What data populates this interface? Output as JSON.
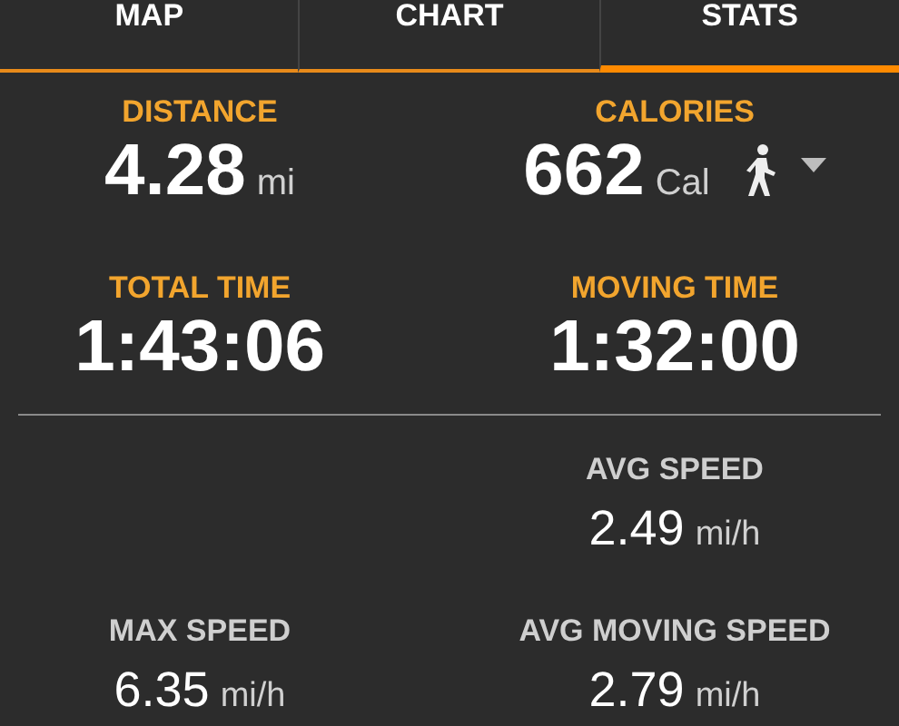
{
  "tabs": [
    {
      "label": "MAP",
      "selected": false
    },
    {
      "label": "CHART",
      "selected": false
    },
    {
      "label": "STATS",
      "selected": true
    }
  ],
  "summary_rows": [
    {
      "left": {
        "label": "DISTANCE",
        "value": "4.28",
        "unit": "mi",
        "activity_picker": false
      },
      "right": {
        "label": "CALORIES",
        "value": "662",
        "unit": "Cal",
        "activity_picker": true
      }
    },
    {
      "left": {
        "label": "TOTAL TIME",
        "value": "1:43:06",
        "activity_picker": false
      },
      "right": {
        "label": "MOVING TIME",
        "value": "1:32:00",
        "activity_picker": false
      }
    }
  ],
  "speed_rows": [
    {
      "right": {
        "label": "AVG SPEED",
        "value": "2.49",
        "unit": "mi/h"
      }
    },
    {
      "left": {
        "label": "MAX SPEED",
        "value": "6.35",
        "unit": "mi/h"
      },
      "right": {
        "label": "AVG MOVING SPEED",
        "value": "2.79",
        "unit": "mi/h"
      }
    }
  ]
}
